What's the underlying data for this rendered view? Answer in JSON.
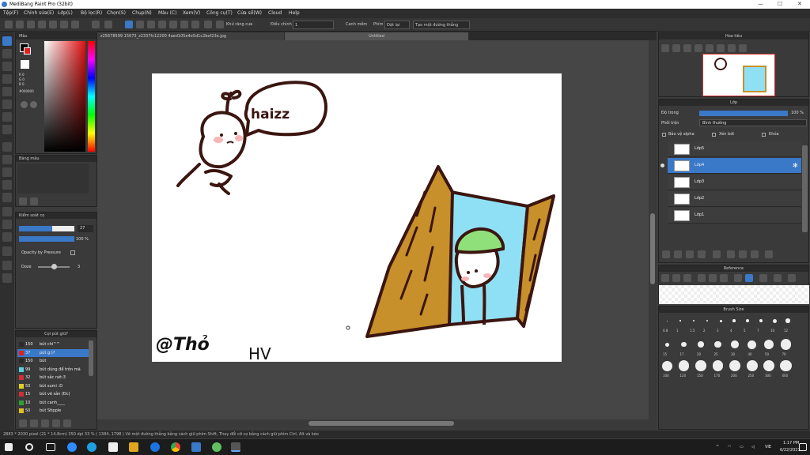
{
  "app": {
    "title": "MediBang Paint Pro (32bit)",
    "window_min": "—",
    "window_max": "☐",
    "window_close": "✕"
  },
  "menu": [
    "Tệp(F)",
    "Chỉnh sửa(E)",
    "Lớp(L)",
    "Bộ lọc(R)",
    "Chọn(S)",
    "Chụp(N)",
    "Màu (C)",
    "Xem(V)",
    "Công cụ(T)",
    "Cửa sổ(W)",
    "Cloud",
    "Help"
  ],
  "toolbar": {
    "antialias_label": "Khử răng cưa",
    "adjust_label": "Điều chỉnh",
    "adjust_value": "1",
    "snap_label": "Canh mềm",
    "key_label": "Phím",
    "cancel_label": "Đặt lại",
    "ruler_label": "Tạo một đường thẳng"
  },
  "tabs": {
    "file_tab": "z25678599 15673_z2337fc12200 4aed105e4e5d1c2bef23e.jpg",
    "untitled_tab": "Untitled"
  },
  "left": {
    "color_panel_title": "Màu",
    "color_r": "R 0",
    "color_g": "G 0",
    "color_b": "B 0",
    "color_hex": "#000000",
    "palette_title": "Bảng màu",
    "brush_control_title": "Kiểm soát cọ",
    "brush_size_value": "27",
    "brush_opacity_value": "100 %",
    "brush_size_fill": 0.6,
    "brush_opacity_fill": 1.0,
    "opacity_pressure_label": "Opacity by Pressure",
    "dose_label": "Doze",
    "dose_value": "3",
    "dose_level": 0.5,
    "brush_list_title": "Cọi pút giữ?",
    "brushes": [
      {
        "size": "150",
        "name": "bút chì^^",
        "color": "#2a2a2a"
      },
      {
        "size": "37",
        "name": "pút g:)?",
        "color": "#e02020"
      },
      {
        "size": "150",
        "name": "bút",
        "color": "#2a2a2a"
      },
      {
        "size": "99",
        "name": "bút dùng để trôn mã",
        "color": "#5ad0e0"
      },
      {
        "size": "32",
        "name": "bút sắc nét:3",
        "color": "#d03030"
      },
      {
        "size": "50",
        "name": "bút sumi :D",
        "color": "#e0d020"
      },
      {
        "size": "15",
        "name": "bút vẽ sản (Đc)",
        "color": "#d03030"
      },
      {
        "size": "10",
        "name": "bút canh____",
        "color": "#30a030"
      },
      {
        "size": "50",
        "name": "bút Stipple",
        "color": "#e0c020"
      }
    ]
  },
  "right": {
    "navigator_title": "Hoa tiêu",
    "layer_title": "Lớp",
    "opacity_label": "Độ trong",
    "opacity_value": "100 %",
    "opacity_fill": 1.0,
    "blend_label": "Phối trộn",
    "blend_value": "Bình thường",
    "protect_alpha": "Bảo vệ alpha",
    "clipping": "Xén bớt",
    "lock": "Khóa",
    "layers": [
      {
        "name": "Lớp5",
        "selected": false
      },
      {
        "name": "Lớp4",
        "selected": true
      },
      {
        "name": "Lớp3",
        "selected": false
      },
      {
        "name": "Lớp2",
        "selected": false
      },
      {
        "name": "Lớp1",
        "selected": false
      }
    ],
    "reference_title": "Reference",
    "brush_size_title": "Brush Size",
    "brush_sizes_row1": [
      "0.8",
      "1",
      "1.5",
      "2",
      "3",
      "4",
      "5",
      "7",
      "10",
      "12"
    ],
    "brush_sizes_row2": [
      "15",
      "17",
      "20",
      "25",
      "30",
      "40",
      "50",
      "70"
    ],
    "brush_sizes_row3": [
      "100",
      "120",
      "150",
      "170",
      "200",
      "250",
      "300",
      "400"
    ]
  },
  "canvas_text": {
    "speech": "haizz",
    "signature": "@Thỏ",
    "initials": "HV"
  },
  "status": "2883 * 2030 pixel  (21 * 14.8cm)  350 dpi  33 %  ( 1384, 1798 )  Vẽ một đường thẳng bằng cách giữ phím Shift, Thay đổi cỡ cọ bằng cách giữ phím Ctrl, Alt và kéo",
  "taskbar": {
    "time": "1:17 PM",
    "date": "6/22/2021",
    "lang": "VIE"
  },
  "colors": {
    "accent": "#3a78c8",
    "ink": "#3b1510",
    "window_blue": "#8fe0f5",
    "door_brown": "#c8902a",
    "hat_green": "#8fe07a",
    "blush": "#f7b5b5"
  }
}
